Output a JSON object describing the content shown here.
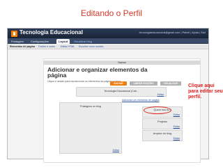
{
  "slide": {
    "title": "Editando o Perfil"
  },
  "topbar": {
    "blog_name": "Tecnologia Educacional",
    "account_email": "tecnologiaeducacional@gmail.com",
    "links": [
      "Painel",
      "Ajuda",
      "Sair"
    ]
  },
  "tabs": [
    {
      "label": "Postagem"
    },
    {
      "label": "Configurações"
    },
    {
      "label": "Layout"
    },
    {
      "label": "Visualizar blog"
    }
  ],
  "subtabs": [
    {
      "label": "Elementos de página"
    },
    {
      "label": "Fontes e cores"
    },
    {
      "label": "Editar HTML"
    },
    {
      "label": "Escolher novo modelo"
    }
  ],
  "editor": {
    "navbar_label": "Navbar",
    "heading": "Adicionar e organizar elementos da página",
    "hint": "Clique e araste para reposicionar os elementos da página no blog.",
    "buttons": {
      "save": "SALVAR",
      "clear": "LIMPAR EDIÇÕES",
      "preview": "VISUALIZAR"
    },
    "edit_link": "Editar",
    "header_title": "Tecnologia Educacional (Cab...",
    "add_gadget": "Adicionar um elemento de página",
    "posts_title": "Postagens no blog",
    "gadgets": [
      {
        "title": "Quem sou eu?",
        "edit": "Editar"
      },
      {
        "title": "Projetos",
        "edit": "Editar"
      },
      {
        "title": "Arquivo do blog",
        "edit": "Editar"
      }
    ]
  },
  "callout": "Clique aqui para editar seu perfil."
}
